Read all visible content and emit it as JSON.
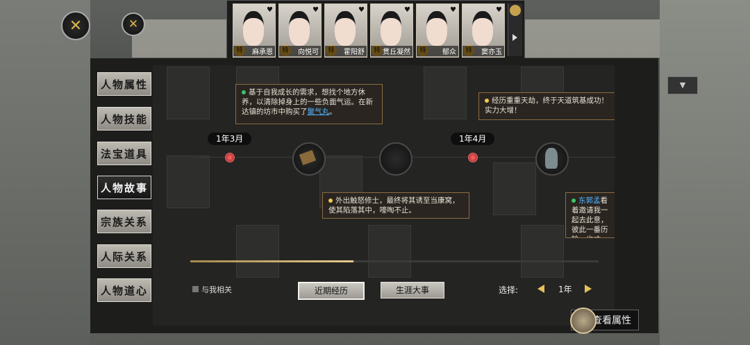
{
  "portraits": [
    {
      "name": "麻承恩",
      "badge": "特"
    },
    {
      "name": "向悦可",
      "badge": "特"
    },
    {
      "name": "霍阳舒",
      "badge": "特"
    },
    {
      "name": "贯丘凝然",
      "badge": "特"
    },
    {
      "name": "郁众",
      "badge": "特"
    },
    {
      "name": "窦亦玉",
      "badge": "特"
    }
  ],
  "tabs": [
    "人物属性",
    "人物技能",
    "法宝道具",
    "人物故事",
    "宗族关系",
    "人际关系",
    "人物道心"
  ],
  "active_tab": "人物故事",
  "timeline": {
    "dates": [
      "1年3月",
      "1年4月"
    ],
    "events": [
      {
        "text_a": "基于自我成长的需求，想找个地方休养，以清除掉身上的一些负面气运。在新达镇的坊市中购买了",
        "link": "聚气丸",
        "text_b": "。",
        "dot_color": "#3cc36a"
      },
      {
        "text": "外出触怒修士，最终将其诱至当康窝，使其陷落其中，嚎啕不止。",
        "dot_color": "#f2c94c"
      },
      {
        "text": "经历重重天劫，终于天道筑基成功！实力大增！",
        "dot_color": "#f2c94c"
      },
      {
        "name_link": "东郭孟",
        "text": "看着邀请我一起去此意，彼此一番历险，也才",
        "dot_color": "#3cc36a"
      }
    ],
    "progress": 0.4
  },
  "footer": {
    "related_label": "与我相关",
    "recent_button": "近期经历",
    "milestone_button": "生涯大事",
    "select_label": "选择:",
    "year_value": "1年",
    "view_button": "查看属性"
  }
}
